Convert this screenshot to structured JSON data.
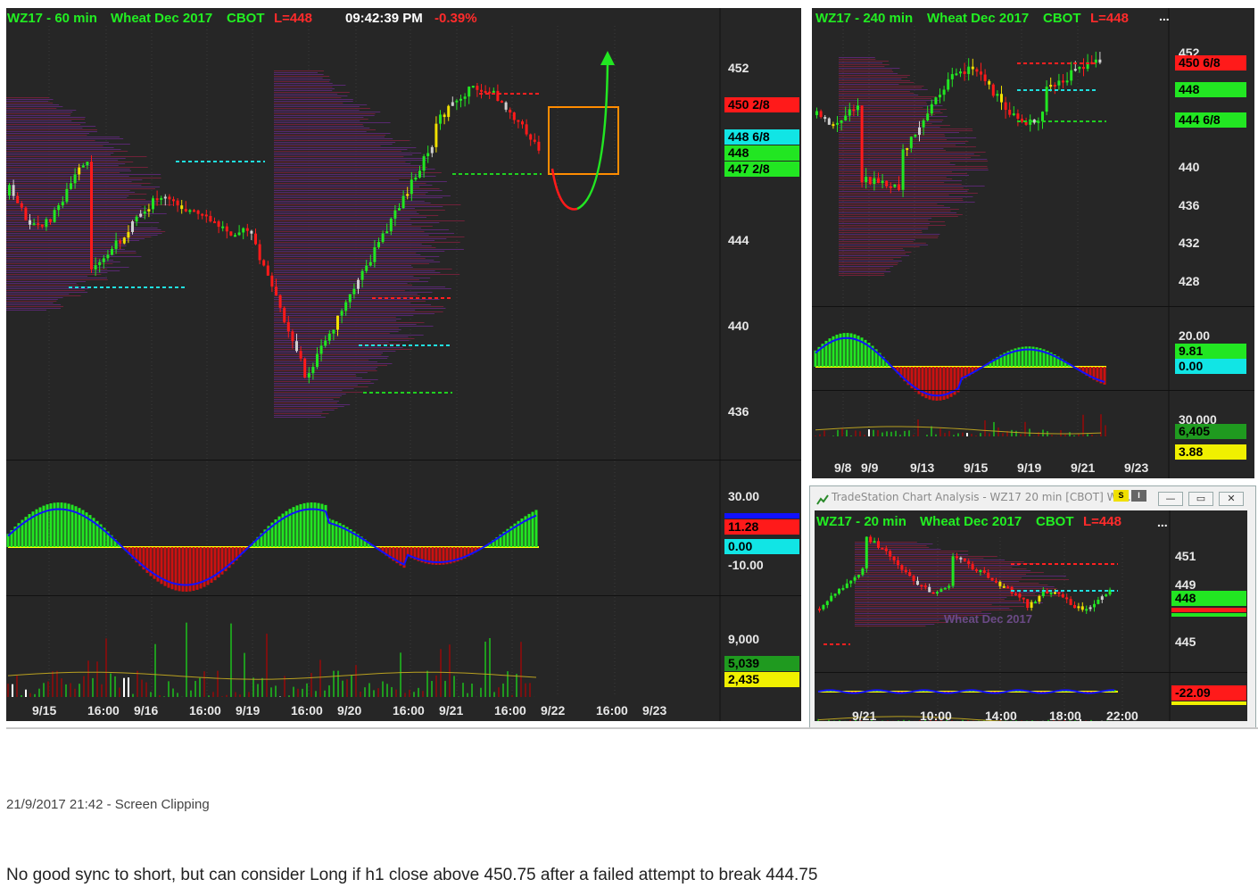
{
  "main_chart": {
    "symbol": "WZ17 - 60 min",
    "name": "Wheat Dec 2017",
    "exchange": "CBOT",
    "last": "L=448",
    "time": "09:42:39 PM",
    "change": "-0.39%",
    "price_axis": [
      "452",
      "444",
      "440",
      "436"
    ],
    "tags": [
      "450 2/8",
      "448 6/8",
      "448",
      "447 2/8"
    ],
    "osc_axis": [
      "30.00",
      "-10.00"
    ],
    "osc_tags": [
      "11.28",
      "0.00"
    ],
    "vol_axis": [
      "9,000"
    ],
    "vol_tags": [
      "5,039",
      "2,435"
    ],
    "x_labels": [
      "9/15",
      "16:00",
      "9/16",
      "16:00",
      "9/19",
      "16:00",
      "9/20",
      "16:00",
      "9/21",
      "16:00",
      "9/22",
      "16:00",
      "9/23"
    ]
  },
  "chart_240": {
    "symbol": "WZ17 - 240 min",
    "name": "Wheat Dec 2017",
    "exchange": "CBOT",
    "last": "L=448",
    "more": "...",
    "price_axis": [
      "452",
      "440",
      "436",
      "432",
      "428"
    ],
    "tags": [
      "450 6/8",
      "448",
      "444 6/8"
    ],
    "osc_axis": [
      "20.00"
    ],
    "osc_tags": [
      "9.81",
      "0.00"
    ],
    "vol_axis": [
      "30,000"
    ],
    "vol_tags": [
      "6,405",
      "3.88"
    ],
    "x_labels": [
      "9/8",
      "9/9",
      "9/13",
      "9/15",
      "9/19",
      "9/21",
      "9/23"
    ]
  },
  "window_20": {
    "title": "TradeStation Chart Analysis - WZ17 20 min [CBOT] Wh...",
    "symbol": "WZ17 - 20 min",
    "name": "Wheat Dec 2017",
    "exchange": "CBOT",
    "last": "L=448",
    "more": "...",
    "watermark": "Wheat Dec 2017",
    "price_axis": [
      "451",
      "449",
      "445"
    ],
    "tags": [
      "448"
    ],
    "osc_tags": [
      "-22.09"
    ],
    "x_labels": [
      "9/21",
      "10:00",
      "14:00",
      "18:00",
      "22:00"
    ],
    "buttons": [
      "—",
      "▭",
      "✕"
    ],
    "badges": [
      "S",
      "I"
    ]
  },
  "note": {
    "timestamp": "21/9/2017 21:42 - Screen Clipping",
    "text": "No good sync to short, but can consider Long if h1 close above 450.75 after a failed attempt to break 444.75"
  },
  "colors": {
    "background": "#262626",
    "up": "#22e622",
    "down": "#ff1a1a",
    "profile": "#5a2a7a",
    "signal": "#1111ff",
    "zero": "#ffff00"
  }
}
